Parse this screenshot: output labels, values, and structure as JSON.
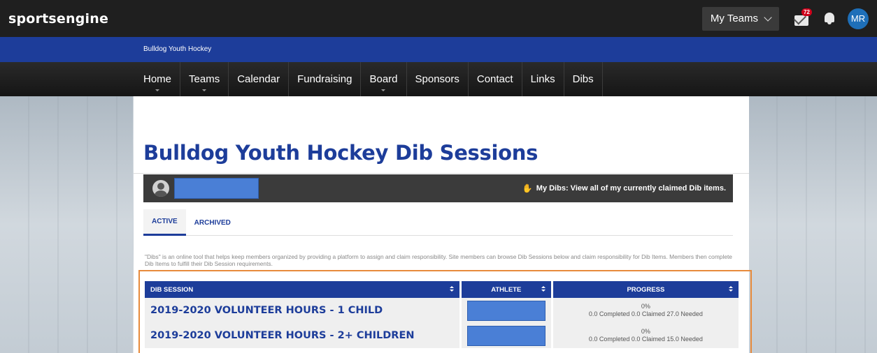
{
  "topbar": {
    "logo_text": "sportsengine",
    "my_teams_label": "My Teams",
    "mail_badge": "72",
    "avatar_initials": "MR"
  },
  "org": {
    "name": "Bulldog Youth Hockey"
  },
  "nav": {
    "items": [
      {
        "label": "Home",
        "has_submenu": true
      },
      {
        "label": "Teams",
        "has_submenu": true
      },
      {
        "label": "Calendar",
        "has_submenu": false
      },
      {
        "label": "Fundraising",
        "has_submenu": false
      },
      {
        "label": "Board",
        "has_submenu": true
      },
      {
        "label": "Sponsors",
        "has_submenu": false
      },
      {
        "label": "Contact",
        "has_submenu": false
      },
      {
        "label": "Links",
        "has_submenu": false
      },
      {
        "label": "Dibs",
        "has_submenu": false
      }
    ]
  },
  "page": {
    "title": "Bulldog Youth Hockey Dib Sessions",
    "my_dibs_text": "My Dibs: View all of my currently claimed Dib items.",
    "tabs": [
      {
        "label": "ACTIVE",
        "active": true
      },
      {
        "label": "ARCHIVED",
        "active": false
      }
    ],
    "description": "\"Dibs\" is an online tool that helps keep members organized by providing a platform to assign and claim responsibility. Site members can browse Dib Sessions below and claim responsibility for Dib Items. Members then complete Dib Items to fulfill their Dib Session requirements."
  },
  "table": {
    "headers": {
      "session": "DIB SESSION",
      "athlete": "ATHLETE",
      "progress": "PROGRESS"
    },
    "rows": [
      {
        "session": "2019-2020 VOLUNTEER HOURS - 1 CHILD",
        "percent": "0%",
        "summary": "0.0 Completed 0.0 Claimed 27.0 Needed"
      },
      {
        "session": "2019-2020 VOLUNTEER HOURS - 2+ CHILDREN",
        "percent": "0%",
        "summary": "0.0 Completed 0.0 Claimed 15.0 Needed"
      }
    ]
  },
  "colors": {
    "brand_blue": "#1d3d9a",
    "highlight_orange": "#e78a3b",
    "redaction_blue": "#4a7fd6"
  }
}
